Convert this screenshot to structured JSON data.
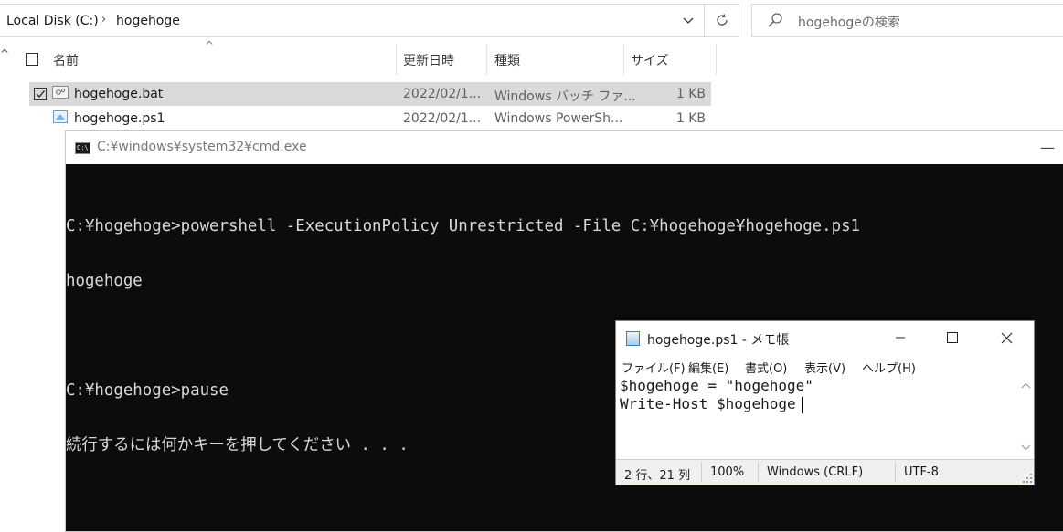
{
  "explorer": {
    "breadcrumb": {
      "root": "Local Disk (C:)",
      "folder": "hogehoge"
    },
    "search": {
      "placeholder": "hogehogeの検索"
    },
    "columns": {
      "name": "名前",
      "date": "更新日時",
      "type": "種類",
      "size": "サイズ"
    },
    "files": [
      {
        "name": "hogehoge.bat",
        "date": "2022/02/1...",
        "type": "Windows バッチ ファ...",
        "size": "1 KB",
        "selected": true,
        "checked": true
      },
      {
        "name": "hogehoge.ps1",
        "date": "2022/02/1...",
        "type": "Windows PowerSh...",
        "size": "1 KB",
        "selected": false,
        "checked": false
      }
    ]
  },
  "cmd": {
    "title": "C:¥windows¥system32¥cmd.exe",
    "lines": [
      "C:¥hogehoge>powershell -ExecutionPolicy Unrestricted -File C:¥hogehoge¥hogehoge.ps1",
      "hogehoge",
      "",
      "C:¥hogehoge>pause",
      "続行するには何かキーを押してください . . ."
    ]
  },
  "notepad": {
    "title": "hogehoge.ps1 - メモ帳",
    "menu": [
      "ファイル(F)",
      "編集(E)",
      "書式(O)",
      "表示(V)",
      "ヘルプ(H)"
    ],
    "content": [
      "$hogehoge = \"hogehoge\"",
      "Write-Host $hogehoge"
    ],
    "status": {
      "position": "2 行、21 列",
      "zoom": "100%",
      "line_ending": "Windows (CRLF)",
      "encoding": "UTF-8"
    }
  },
  "icons": {
    "address_dropdown": "chevron-down-icon",
    "refresh": "refresh-icon",
    "search": "search-icon",
    "sort": "sort-ascending-icon",
    "collapse": "chevron-up-icon",
    "bat_file": "batch-file-icon",
    "ps1_file": "powershell-script-icon",
    "cmd": "cmd-icon",
    "notepad": "notepad-icon",
    "minimize": "minimize-icon",
    "maximize": "maximize-icon",
    "close": "close-icon"
  },
  "colors": {
    "selection": "#d9d9d9",
    "console_bg": "#0c0c0c",
    "console_fg": "#d8d8d8",
    "notepad_border": "#4a90d9"
  }
}
